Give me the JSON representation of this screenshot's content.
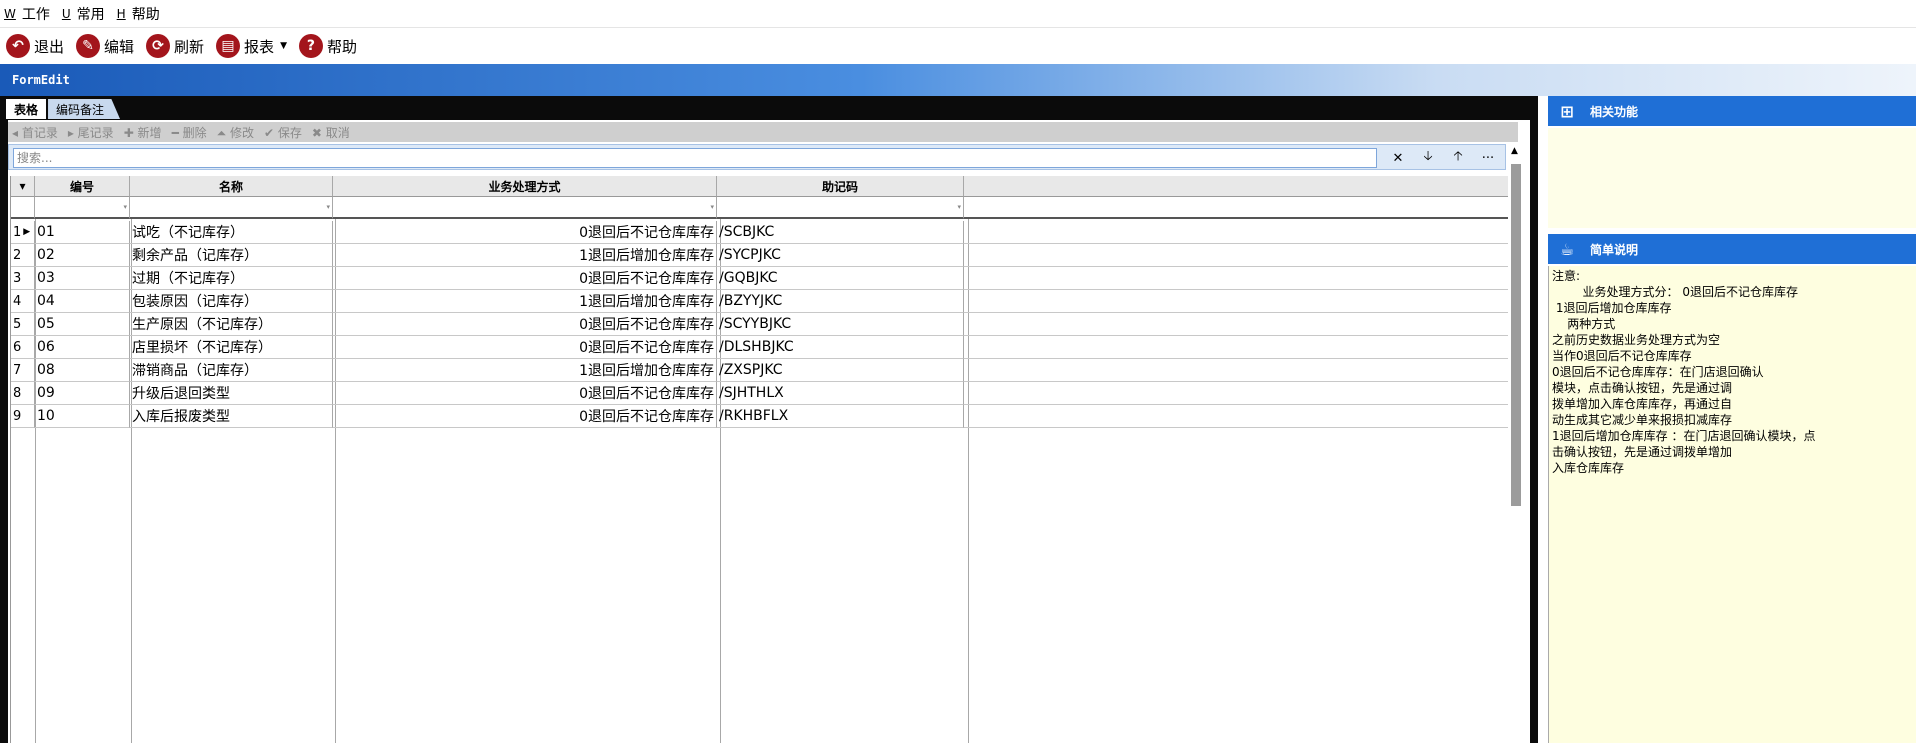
{
  "menu": {
    "items": [
      {
        "hotkey": "W",
        "label": "工作"
      },
      {
        "hotkey": "U",
        "label": "常用"
      },
      {
        "hotkey": "H",
        "label": "帮助"
      }
    ]
  },
  "toolbar": {
    "exit_label": "退出",
    "edit_label": "编辑",
    "refresh_label": "刷新",
    "report_label": "报表",
    "help_label": "帮助"
  },
  "form": {
    "title": "FormEdit"
  },
  "tabs": [
    {
      "label": "表格",
      "active": true
    },
    {
      "label": "编码备注",
      "active": false
    }
  ],
  "navbar": {
    "first": "◂ 首记录",
    "last": "▸ 尾记录",
    "add": "✚ 新增",
    "delete": "━ 删除",
    "modify": "⏶ 修改",
    "save": "✔ 保存",
    "cancel": "✖ 取消"
  },
  "search": {
    "placeholder": "搜索...",
    "clear": "✕",
    "down": "🡣",
    "up": "🡡",
    "more": "···"
  },
  "grid": {
    "columns": [
      "编号",
      "名称",
      "业务处理方式",
      "助记码"
    ],
    "rows": [
      {
        "no": "1",
        "code": "01",
        "name": "试吃（不记库存）",
        "mode": "0退回后不记仓库库存",
        "memo": "/SCBJKC"
      },
      {
        "no": "2",
        "code": "02",
        "name": "剩余产品（记库存）",
        "mode": "1退回后增加仓库库存",
        "memo": "/SYCPJKC"
      },
      {
        "no": "3",
        "code": "03",
        "name": "过期（不记库存）",
        "mode": "0退回后不记仓库库存",
        "memo": "/GQBJKC"
      },
      {
        "no": "4",
        "code": "04",
        "name": "包装原因（记库存）",
        "mode": "1退回后增加仓库库存",
        "memo": "/BZYYJKC"
      },
      {
        "no": "5",
        "code": "05",
        "name": "生产原因（不记库存）",
        "mode": "0退回后不记仓库库存",
        "memo": "/SCYYBJKC"
      },
      {
        "no": "6",
        "code": "06",
        "name": "店里损坏（不记库存）",
        "mode": "0退回后不记仓库库存",
        "memo": "/DLSHBJKC"
      },
      {
        "no": "7",
        "code": "08",
        "name": "滞销商品（记库存）",
        "mode": "1退回后增加仓库库存",
        "memo": "/ZXSPJKC"
      },
      {
        "no": "8",
        "code": "09",
        "name": "升级后退回类型",
        "mode": "0退回后不记仓库库存",
        "memo": "/SJHTHLX"
      },
      {
        "no": "9",
        "code": "10",
        "name": "入库后报废类型",
        "mode": "0退回后不记仓库库存",
        "memo": "/RKHBFLX"
      }
    ]
  },
  "related": {
    "title": "相关功能"
  },
  "notes": {
    "title": "简单说明",
    "lines": [
      "注意:",
      "        业务处理方式分： 0退回后不记仓库库存",
      " 1退回后增加仓库库存",
      "    两种方式",
      "之前历史数据业务处理方式为空",
      "当作0退回后不记仓库库存",
      "0退回后不记仓库库存：在门店退回确认",
      "模块，点击确认按钮，先是通过调",
      "拨单增加入库仓库库存，再通过自",
      "动生成其它减少单来报损扣减库存",
      "1退回后增加仓库库存 ：在门店退回确认模块，点",
      "击确认按钮，先是通过调拨单增加",
      "入库仓库库存"
    ]
  }
}
